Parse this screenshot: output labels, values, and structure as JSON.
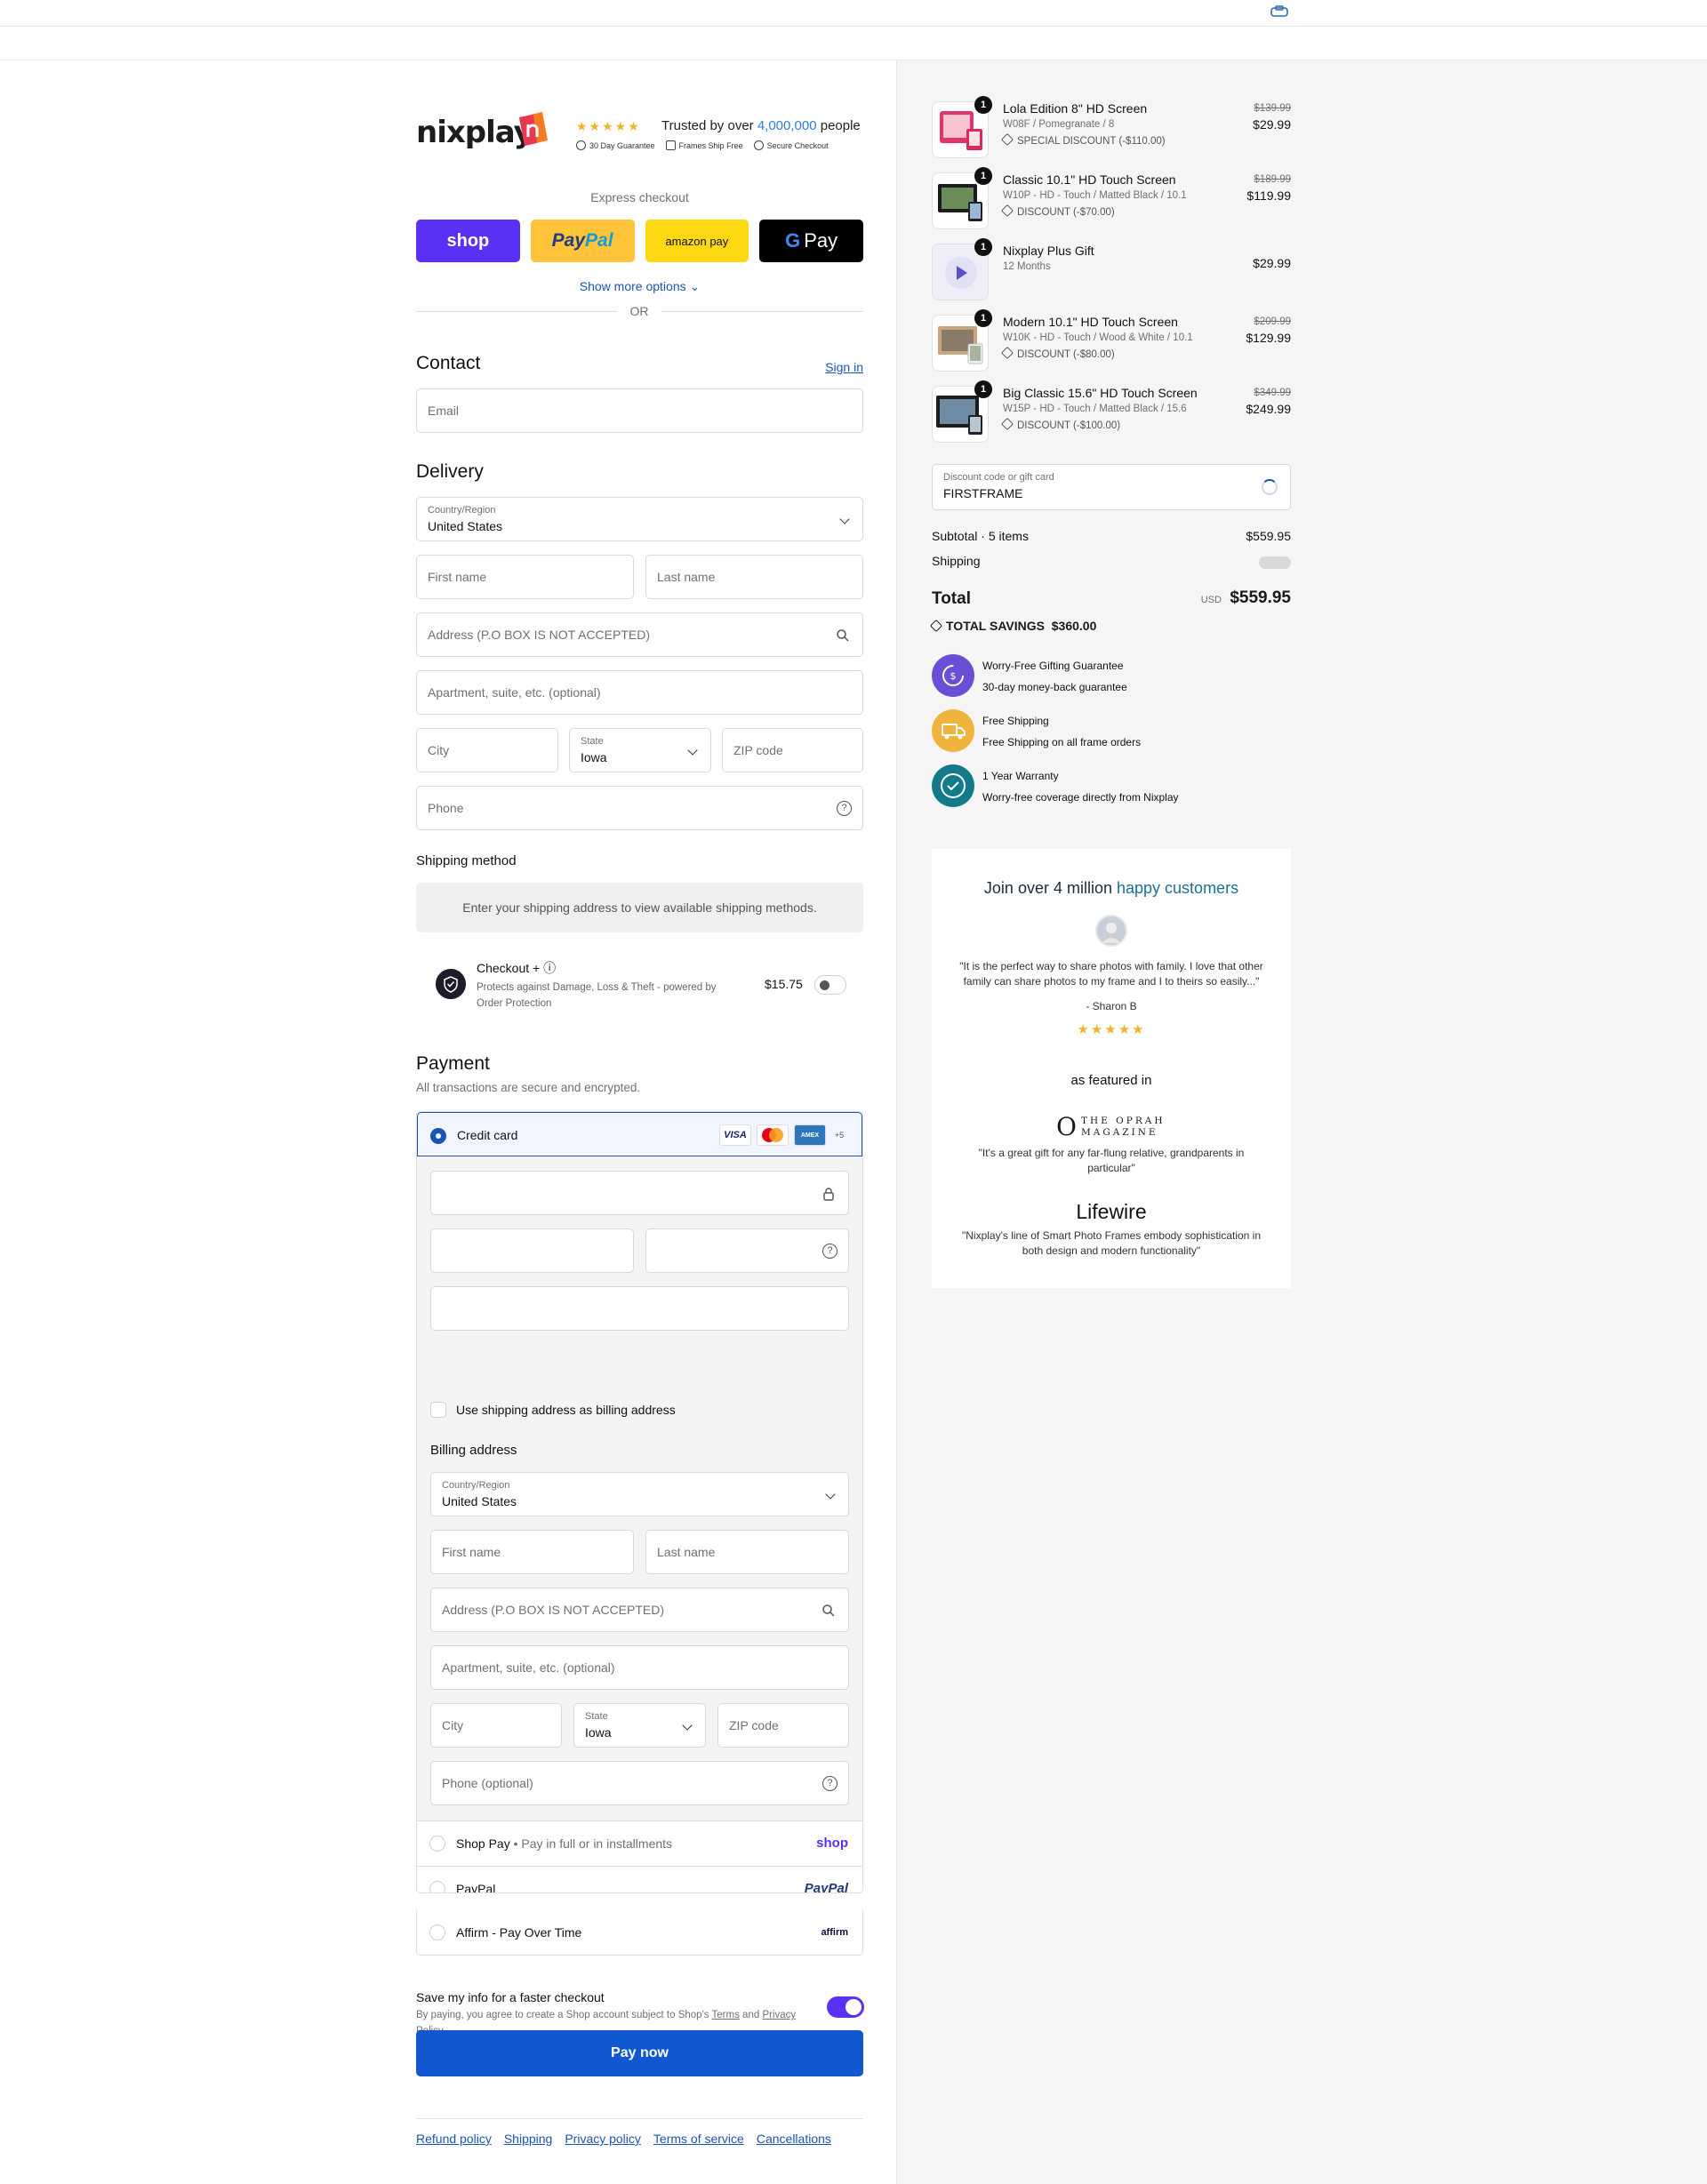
{
  "header": {
    "logo_text": "nixplay",
    "trust_stars": "★★★★★",
    "trust_prefix": "Trusted by over",
    "trust_number": "4,000,000",
    "trust_suffix": "people",
    "badges": [
      "30 Day Guarantee",
      "Frames Ship Free",
      "Secure Checkout"
    ]
  },
  "express": {
    "label": "Express checkout",
    "shop": "shop",
    "paypal_a": "Pay",
    "paypal_b": "Pal",
    "amazon": "amazon pay",
    "gpay_g": "G",
    "gpay": "Pay",
    "show_more": "Show more options ⌄",
    "or": "OR"
  },
  "contact": {
    "title": "Contact",
    "sign_in": "Sign in",
    "email_placeholder": "Email"
  },
  "delivery": {
    "title": "Delivery",
    "country_label": "Country/Region",
    "country_value": "United States",
    "first_name": "First name",
    "last_name": "Last name",
    "address": "Address (P.O BOX IS NOT ACCEPTED)",
    "apartment": "Apartment, suite, etc. (optional)",
    "city": "City",
    "state_label": "State",
    "state_value": "Iowa",
    "zip": "ZIP code",
    "phone": "Phone"
  },
  "shipping": {
    "title": "Shipping method",
    "note": "Enter your shipping address to view available shipping methods."
  },
  "checkout_plus": {
    "title": "Checkout + ⓘ",
    "desc": "Protects against Damage, Loss & Theft - powered by Order Protection",
    "price": "$15.75"
  },
  "payment": {
    "title": "Payment",
    "subtitle": "All transactions are secure and encrypted.",
    "credit_card": "Credit card",
    "card_logos": [
      "VISA",
      "AMEX",
      "+5"
    ],
    "use_shipping": "Use shipping address as billing address",
    "billing_title": "Billing address",
    "billing_country_label": "Country/Region",
    "billing_country": "United States",
    "billing_first": "First name",
    "billing_last": "Last name",
    "billing_address": "Address (P.O BOX IS NOT ACCEPTED)",
    "billing_apartment": "Apartment, suite, etc. (optional)",
    "billing_city": "City",
    "billing_state_label": "State",
    "billing_state": "Iowa",
    "billing_zip": "ZIP code",
    "billing_phone": "Phone (optional)",
    "shop_pay": "Shop Pay",
    "shop_pay_sub": "• Pay in full or in installments",
    "shop_pay_brand": "shop",
    "paypal": "PayPal",
    "paypal_brand": "PayPal",
    "affirm": "Affirm - Pay Over Time",
    "affirm_brand": "affirm"
  },
  "save_info": {
    "title": "Save my info for a faster checkout",
    "desc_prefix": "By paying, you agree to create a Shop account subject to Shop's",
    "terms": "Terms",
    "and": "and",
    "privacy": "Privacy Policy"
  },
  "pay_now": "Pay now",
  "footer_links": [
    "Refund policy",
    "Shipping",
    "Privacy policy",
    "Terms of service",
    "Cancellations"
  ],
  "items": [
    {
      "qty": "1",
      "name": "Lola Edition 8\" HD Screen",
      "variant": "W08F / Pomegranate / 8",
      "discount": "SPECIAL DISCOUNT (-$110.00)",
      "old": "$139.99",
      "price": "$29.99"
    },
    {
      "qty": "1",
      "name": "Classic 10.1\" HD Touch Screen",
      "variant": "W10P - HD - Touch / Matted Black / 10.1",
      "discount": "DISCOUNT (-$70.00)",
      "old": "$189.99",
      "price": "$119.99"
    },
    {
      "qty": "1",
      "name": "Nixplay Plus Gift",
      "variant": "12 Months",
      "discount": "",
      "old": "",
      "price": "$29.99"
    },
    {
      "qty": "1",
      "name": "Modern 10.1\" HD Touch Screen",
      "variant": "W10K - HD - Touch / Wood & White / 10.1",
      "discount": "DISCOUNT (-$80.00)",
      "old": "$209.99",
      "price": "$129.99"
    },
    {
      "qty": "1",
      "name": "Big Classic 15.6\" HD Touch Screen",
      "variant": "W15P - HD - Touch / Matted Black / 15.6",
      "discount": "DISCOUNT (-$100.00)",
      "old": "$349.99",
      "price": "$249.99"
    }
  ],
  "discount_field": {
    "label": "Discount code or gift card",
    "value": "FIRSTFRAME"
  },
  "summary": {
    "subtotal_label": "Subtotal · 5 items",
    "subtotal": "$559.95",
    "shipping_label": "Shipping",
    "total_label": "Total",
    "currency": "USD",
    "total": "$559.95",
    "savings_label": "TOTAL SAVINGS",
    "savings": "$360.00"
  },
  "guarantees": [
    {
      "title": "Worry-Free Gifting Guarantee",
      "desc": "30-day money-back guarantee",
      "color": "#6a4fd6"
    },
    {
      "title": "Free Shipping",
      "desc": "Free Shipping on all frame orders",
      "color": "#f0b43c"
    },
    {
      "title": "1 Year Warranty",
      "desc": "Worry-free coverage directly from Nixplay",
      "color": "#137a8a"
    }
  ],
  "review": {
    "title_a": "Join over 4 million",
    "title_b": "happy customers",
    "quote": "\"It is the perfect way to share photos with family. I love that other family can share photos to my frame and I to theirs so easily...\"",
    "author": "- Sharon B",
    "stars": "★★★★★",
    "featured": "as featured in",
    "oprah_O": "O",
    "oprah_text1": "THE OPRAH",
    "oprah_text2": "MAGAZINE",
    "oprah_quote": "\"It's a great gift for any far-flung relative, grandparents in particular\"",
    "lifewire": "Lifewire",
    "lifewire_quote": "\"Nixplay's line of Smart Photo Frames embody sophistication in both design and modern functionality\""
  },
  "colors": {
    "accent": "#1057d0",
    "shop": "#5a31f4",
    "paypal_bg": "#ffc439",
    "teal": "#1f6f93"
  }
}
